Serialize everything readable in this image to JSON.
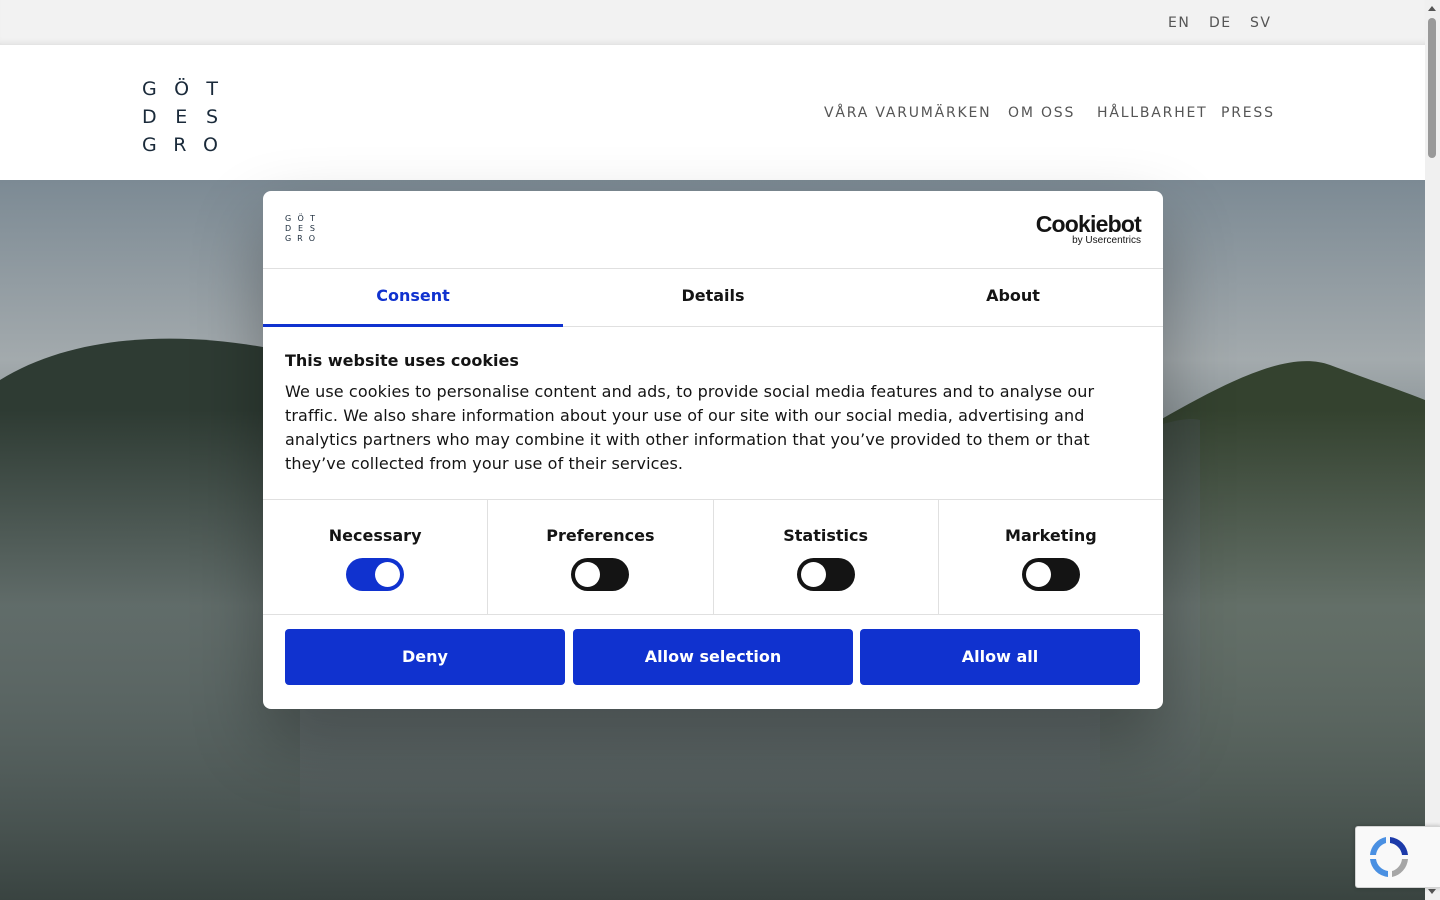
{
  "languages": [
    "EN",
    "DE",
    "SV"
  ],
  "logo": {
    "rows": [
      [
        "G",
        "Ö",
        "T"
      ],
      [
        "D",
        "E",
        "S"
      ],
      [
        "G",
        "R",
        "O"
      ]
    ]
  },
  "nav": [
    "VÅRA VARUMÄRKEN",
    "OM OSS",
    "HÅLLBARHET",
    "PRESS"
  ],
  "dialog": {
    "brand": "Cookiebot",
    "brand_sub": "by Usercentrics",
    "tabs": [
      "Consent",
      "Details",
      "About"
    ],
    "active_tab": "Consent",
    "title": "This website uses cookies",
    "text": "We use cookies to personalise content and ads, to provide social media features and to analyse our traffic. We also share information about your use of our site with our social media, advertising and analytics partners who may combine it with other information that you’ve provided to them or that they’ve collected from your use of their services.",
    "toggles": [
      {
        "label": "Necessary",
        "on": true
      },
      {
        "label": "Preferences",
        "on": false
      },
      {
        "label": "Statistics",
        "on": false
      },
      {
        "label": "Marketing",
        "on": false
      }
    ],
    "buttons": [
      "Deny",
      "Allow selection",
      "Allow all"
    ]
  },
  "colors": {
    "accent": "#1032cf",
    "dark": "#141414",
    "logo": "#1a2a3a"
  },
  "icons": {
    "recaptcha": "recaptcha-icon"
  }
}
